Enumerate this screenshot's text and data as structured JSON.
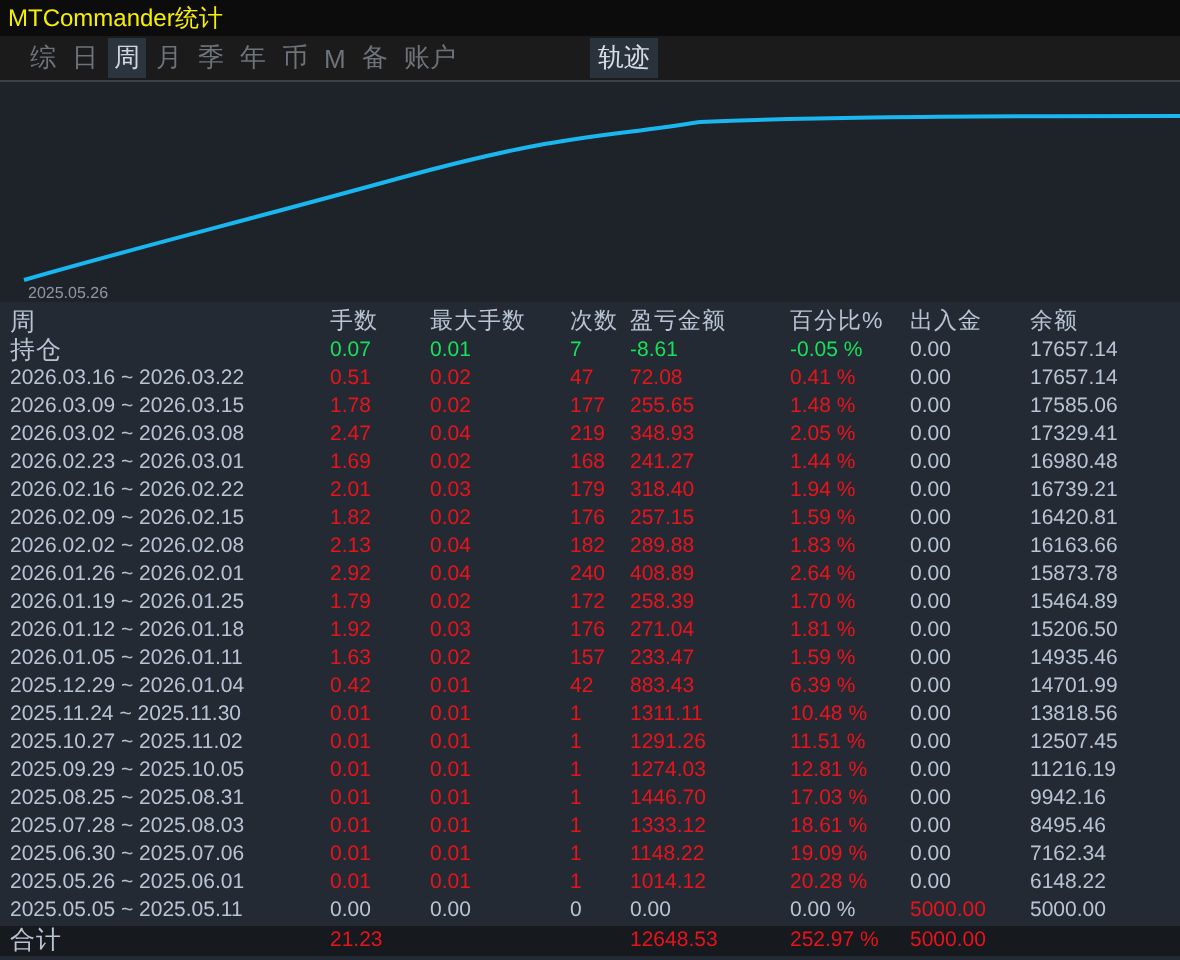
{
  "window": {
    "title": "MTCommander统计"
  },
  "tabs": [
    {
      "label": "综",
      "selected": false
    },
    {
      "label": "日",
      "selected": false
    },
    {
      "label": "周",
      "selected": true
    },
    {
      "label": "月",
      "selected": false
    },
    {
      "label": "季",
      "selected": false
    },
    {
      "label": "年",
      "selected": false
    },
    {
      "label": "币",
      "selected": false
    },
    {
      "label": "M",
      "selected": false
    },
    {
      "label": "备",
      "selected": false
    },
    {
      "label": "账户",
      "selected": false
    }
  ],
  "view_button": {
    "label": "轨迹"
  },
  "chart": {
    "start_label": "2025.05.26"
  },
  "table": {
    "columns": [
      "周",
      "手数",
      "最大手数",
      "次数",
      "盈亏金额",
      "百分比%",
      "出入金",
      "余额"
    ],
    "rows": [
      {
        "kind": "position",
        "cells": [
          "持仓",
          "0.07",
          "0.01",
          "7",
          "-8.61",
          "-0.05 %",
          "0.00",
          "17657.14"
        ]
      },
      {
        "kind": "gain",
        "cells": [
          "2026.03.16 ~ 2026.03.22",
          "0.51",
          "0.02",
          "47",
          "72.08",
          "0.41 %",
          "0.00",
          "17657.14"
        ]
      },
      {
        "kind": "gain",
        "cells": [
          "2026.03.09 ~ 2026.03.15",
          "1.78",
          "0.02",
          "177",
          "255.65",
          "1.48 %",
          "0.00",
          "17585.06"
        ]
      },
      {
        "kind": "gain",
        "cells": [
          "2026.03.02 ~ 2026.03.08",
          "2.47",
          "0.04",
          "219",
          "348.93",
          "2.05 %",
          "0.00",
          "17329.41"
        ]
      },
      {
        "kind": "gain",
        "cells": [
          "2026.02.23 ~ 2026.03.01",
          "1.69",
          "0.02",
          "168",
          "241.27",
          "1.44 %",
          "0.00",
          "16980.48"
        ]
      },
      {
        "kind": "gain",
        "cells": [
          "2026.02.16 ~ 2026.02.22",
          "2.01",
          "0.03",
          "179",
          "318.40",
          "1.94 %",
          "0.00",
          "16739.21"
        ]
      },
      {
        "kind": "gain",
        "cells": [
          "2026.02.09 ~ 2026.02.15",
          "1.82",
          "0.02",
          "176",
          "257.15",
          "1.59 %",
          "0.00",
          "16420.81"
        ]
      },
      {
        "kind": "gain",
        "cells": [
          "2026.02.02 ~ 2026.02.08",
          "2.13",
          "0.04",
          "182",
          "289.88",
          "1.83 %",
          "0.00",
          "16163.66"
        ]
      },
      {
        "kind": "gain",
        "cells": [
          "2026.01.26 ~ 2026.02.01",
          "2.92",
          "0.04",
          "240",
          "408.89",
          "2.64 %",
          "0.00",
          "15873.78"
        ]
      },
      {
        "kind": "gain",
        "cells": [
          "2026.01.19 ~ 2026.01.25",
          "1.79",
          "0.02",
          "172",
          "258.39",
          "1.70 %",
          "0.00",
          "15464.89"
        ]
      },
      {
        "kind": "gain",
        "cells": [
          "2026.01.12 ~ 2026.01.18",
          "1.92",
          "0.03",
          "176",
          "271.04",
          "1.81 %",
          "0.00",
          "15206.50"
        ]
      },
      {
        "kind": "gain",
        "cells": [
          "2026.01.05 ~ 2026.01.11",
          "1.63",
          "0.02",
          "157",
          "233.47",
          "1.59 %",
          "0.00",
          "14935.46"
        ]
      },
      {
        "kind": "gain",
        "cells": [
          "2025.12.29 ~ 2026.01.04",
          "0.42",
          "0.01",
          "42",
          "883.43",
          "6.39 %",
          "0.00",
          "14701.99"
        ]
      },
      {
        "kind": "gain",
        "cells": [
          "2025.11.24 ~ 2025.11.30",
          "0.01",
          "0.01",
          "1",
          "1311.11",
          "10.48 %",
          "0.00",
          "13818.56"
        ]
      },
      {
        "kind": "gain",
        "cells": [
          "2025.10.27 ~ 2025.11.02",
          "0.01",
          "0.01",
          "1",
          "1291.26",
          "11.51 %",
          "0.00",
          "12507.45"
        ]
      },
      {
        "kind": "gain",
        "cells": [
          "2025.09.29 ~ 2025.10.05",
          "0.01",
          "0.01",
          "1",
          "1274.03",
          "12.81 %",
          "0.00",
          "11216.19"
        ]
      },
      {
        "kind": "gain",
        "cells": [
          "2025.08.25 ~ 2025.08.31",
          "0.01",
          "0.01",
          "1",
          "1446.70",
          "17.03 %",
          "0.00",
          "9942.16"
        ]
      },
      {
        "kind": "gain",
        "cells": [
          "2025.07.28 ~ 2025.08.03",
          "0.01",
          "0.01",
          "1",
          "1333.12",
          "18.61 %",
          "0.00",
          "8495.46"
        ]
      },
      {
        "kind": "gain",
        "cells": [
          "2025.06.30 ~ 2025.07.06",
          "0.01",
          "0.01",
          "1",
          "1148.22",
          "19.09 %",
          "0.00",
          "7162.34"
        ]
      },
      {
        "kind": "gain",
        "cells": [
          "2025.05.26 ~ 2025.06.01",
          "0.01",
          "0.01",
          "1",
          "1014.12",
          "20.28 %",
          "0.00",
          "6148.22"
        ]
      },
      {
        "kind": "start",
        "cells": [
          "2025.05.05 ~ 2025.05.11",
          "0.00",
          "0.00",
          "0",
          "0.00",
          "0.00 %",
          "5000.00",
          "5000.00"
        ]
      }
    ],
    "total": {
      "label": "合计",
      "lots": "21.23",
      "profit": "12648.53",
      "percent": "252.97 %",
      "deposit": "5000.00"
    }
  }
}
